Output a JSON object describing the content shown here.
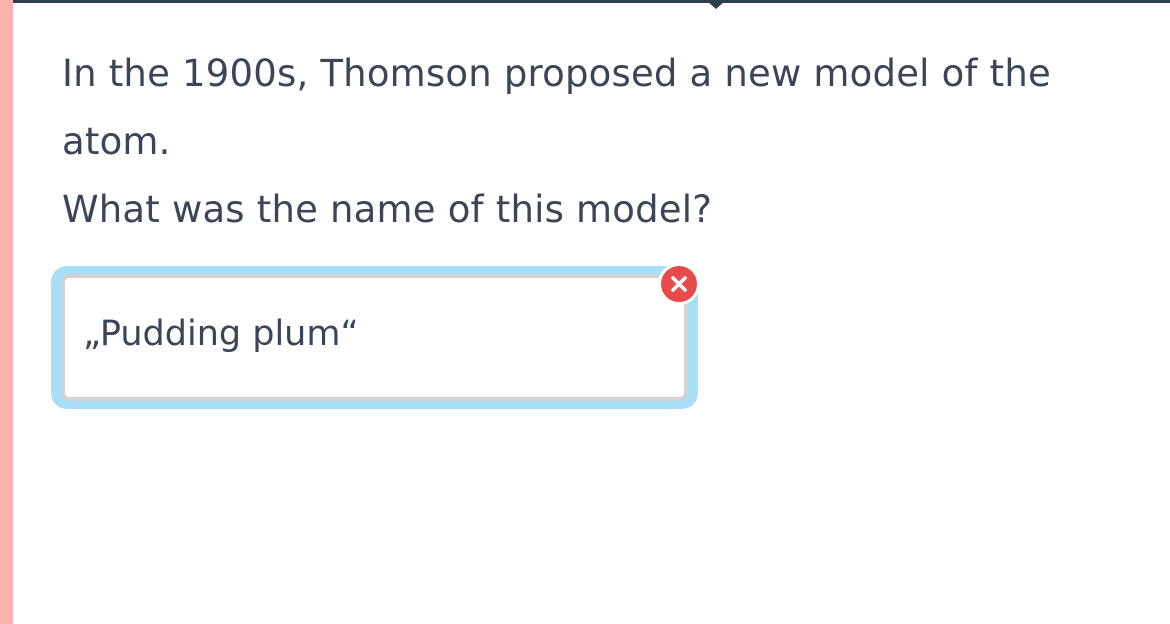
{
  "question": {
    "line1": "In the 1900s, Thomson proposed a new model of the atom.",
    "line2": "What was the name of this model?"
  },
  "answer": {
    "value": "„Pudding plum“",
    "status": "incorrect",
    "status_icon": "close-icon"
  },
  "colors": {
    "text": "#3a4657",
    "left_strip": "#fbb1ad",
    "answer_highlight": "#a6dff7",
    "wrong_badge": "#e94a4a"
  }
}
